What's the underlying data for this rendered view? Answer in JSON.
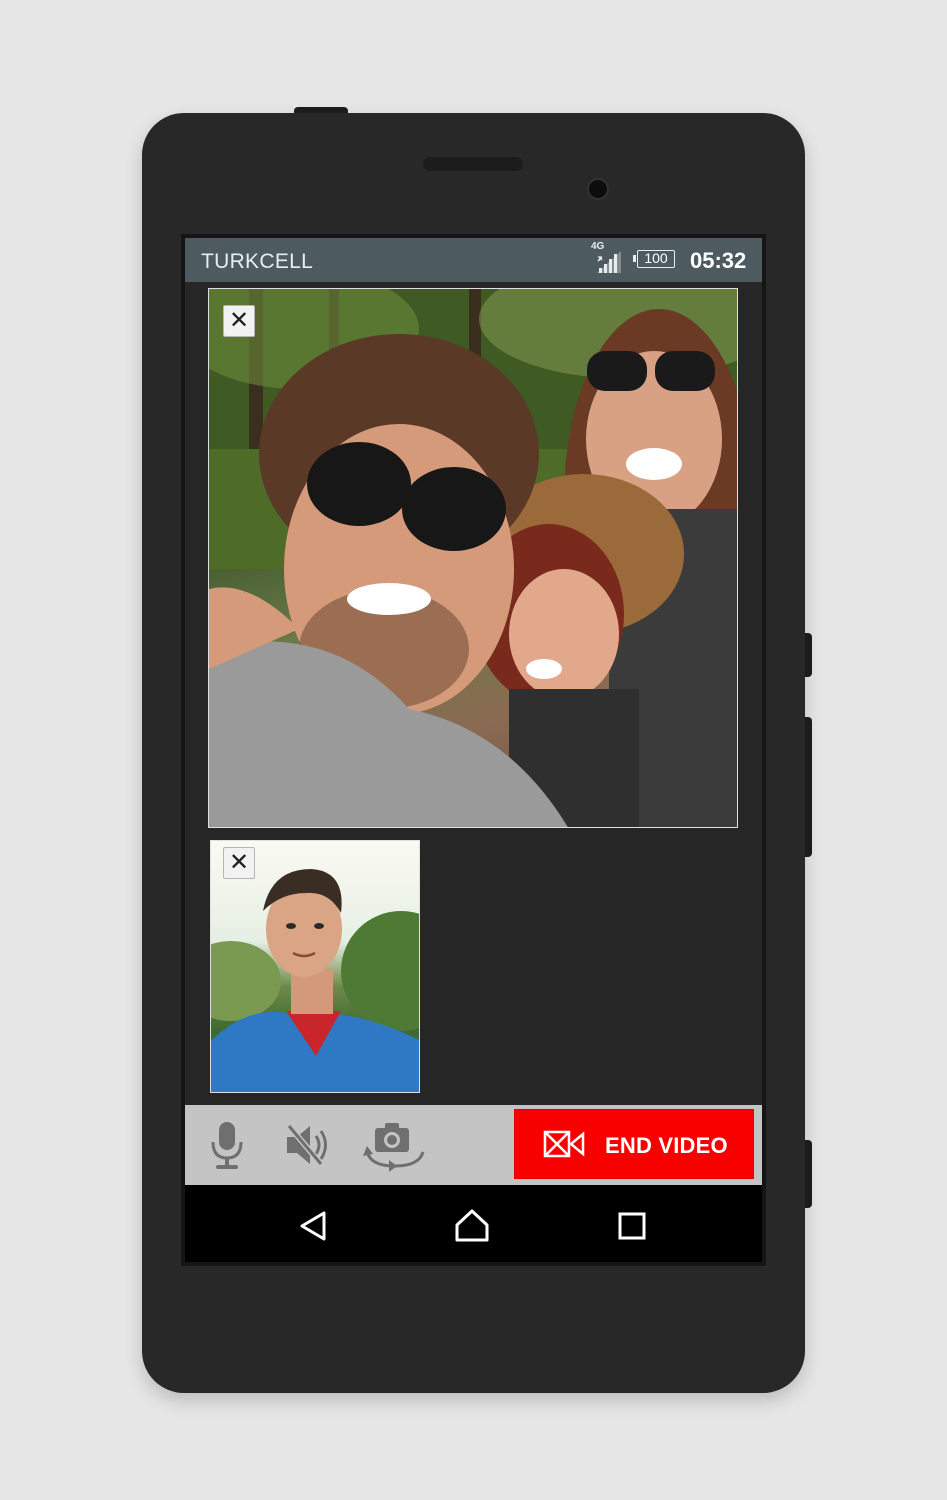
{
  "status_bar": {
    "carrier": "TURKCELL",
    "network_type": "4G",
    "battery": "100",
    "time": "05:32"
  },
  "main_video": {
    "close_symbol": "✕",
    "content_description": "group-selfie-remote-participants"
  },
  "self_video": {
    "close_symbol": "✕",
    "content_description": "self-preview-camera"
  },
  "controls": {
    "mic_icon": "microphone-icon",
    "speaker_icon": "speaker-muted-icon",
    "camera_icon": "switch-camera-icon",
    "end_video_label": "END VIDEO",
    "end_video_icon": "video-off-icon",
    "end_color": "#f90000"
  },
  "nav_bar": {
    "back_icon": "back-triangle-icon",
    "home_icon": "home-icon",
    "recents_icon": "recents-square-icon"
  },
  "colors": {
    "status_bar": "#4d5a60",
    "controls_bar": "#c4c4c4",
    "phone_body": "#282828"
  }
}
